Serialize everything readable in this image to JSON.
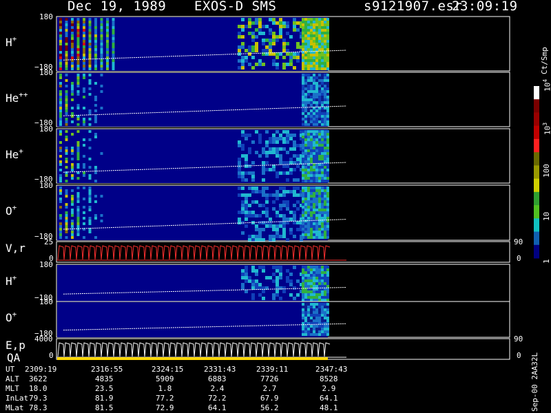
{
  "header": {
    "date": "Dec 19, 1989",
    "instrument": "EXOS-D SMS",
    "file": "s9121907.esr",
    "time": "23:09:19"
  },
  "panels": [
    {
      "id": "H",
      "label": "H",
      "sup": "+",
      "ymax": "180",
      "ymin": "−180"
    },
    {
      "id": "He2",
      "label": "He",
      "sup": "++",
      "ymax": "180",
      "ymin": "−180"
    },
    {
      "id": "He1",
      "label": "He",
      "sup": "+",
      "ymax": "180",
      "ymin": "−180"
    },
    {
      "id": "O",
      "label": "O",
      "sup": "+",
      "ymax": "180",
      "ymin": "−180"
    },
    {
      "id": "Vr",
      "label": "V,r",
      "sup": "",
      "ymax": "25",
      "ymin": "0",
      "rmax": "90",
      "rmin": "0"
    },
    {
      "id": "H2",
      "label": "H",
      "sup": "+",
      "ymax": "180",
      "ymin": "−180"
    },
    {
      "id": "O2",
      "label": "O",
      "sup": "+",
      "ymax": "180",
      "ymin": "−180"
    },
    {
      "id": "Ep",
      "label": "E,p",
      "sup": "",
      "ymax": "4000",
      "ymin": "0",
      "rmax": "90",
      "rmin": "0"
    }
  ],
  "qa_label": "QA",
  "colorbar": {
    "units": "Ct/Smp",
    "ticks": [
      {
        "base": "10",
        "exp": "4",
        "frac": 0.0
      },
      {
        "base": "10",
        "exp": "3",
        "frac": 0.25
      },
      {
        "base": "100",
        "exp": "",
        "frac": 0.5
      },
      {
        "base": "10",
        "exp": "",
        "frac": 0.75
      },
      {
        "base": "1",
        "exp": "",
        "frac": 1.0
      }
    ]
  },
  "footer": {
    "side_label": "Sep-00 2AA32L",
    "rows": [
      {
        "name": "UT",
        "values": [
          "2309:19",
          "2316:55",
          "2324:15",
          "2331:43",
          "2339:11",
          "2347:43"
        ]
      },
      {
        "name": "ALT",
        "values": [
          "3622",
          "4835",
          "5909",
          "6883",
          "7726",
          "8528"
        ]
      },
      {
        "name": "MLT",
        "values": [
          "18.0",
          "23.5",
          "1.8",
          "2.4",
          "2.7",
          "2.9"
        ]
      },
      {
        "name": "InLat",
        "values": [
          "79.3",
          "81.9",
          "77.2",
          "72.2",
          "67.9",
          "64.1"
        ]
      },
      {
        "name": "MLat",
        "values": [
          "78.3",
          "81.5",
          "72.9",
          "64.1",
          "56.2",
          "48.1"
        ]
      }
    ]
  },
  "chart_data": {
    "type": "heatmap",
    "title": "Dec 19, 1989   EXOS-D SMS",
    "x_ticks": [
      "2309:19",
      "2316:55",
      "2324:15",
      "2331:43",
      "2339:11",
      "2347:43"
    ],
    "data_coverage_fraction": 0.59,
    "panels": [
      {
        "name": "H+",
        "ylim": [
          -180,
          180
        ],
        "scale": "Ct/Smp log 1-10^4"
      },
      {
        "name": "He++",
        "ylim": [
          -180,
          180
        ],
        "scale": "Ct/Smp log 1-10^4"
      },
      {
        "name": "He+",
        "ylim": [
          -180,
          180
        ],
        "scale": "Ct/Smp log 1-10^4"
      },
      {
        "name": "O+",
        "ylim": [
          -180,
          180
        ],
        "scale": "Ct/Smp log 1-10^4"
      },
      {
        "name": "V,r",
        "ylim": [
          0,
          25
        ],
        "right_ylim": [
          0,
          90
        ],
        "type": "line"
      },
      {
        "name": "H+",
        "ylim": [
          -180,
          180
        ],
        "scale": "Ct/Smp log 1-10^4"
      },
      {
        "name": "O+",
        "ylim": [
          -180,
          180
        ],
        "scale": "Ct/Smp log 1-10^4"
      },
      {
        "name": "E,p",
        "ylim": [
          0,
          4000
        ],
        "right_ylim": [
          0,
          90
        ],
        "type": "line"
      }
    ],
    "colorbar": {
      "units": "Ct/Smp",
      "ticks": [
        "1",
        "10",
        "100",
        "10^3",
        "10^4"
      ]
    }
  }
}
